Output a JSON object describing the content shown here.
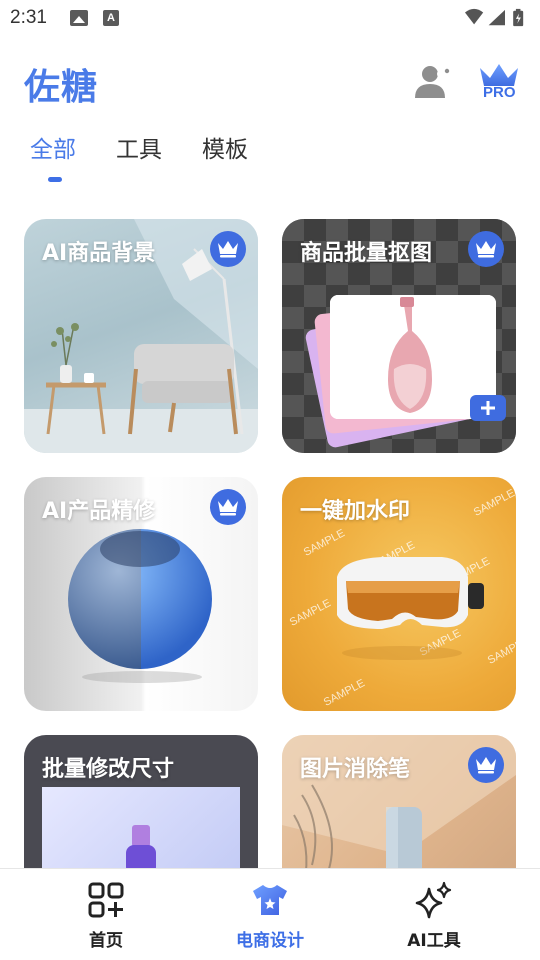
{
  "status_bar": {
    "time": "2:31",
    "notification_icons": [
      "image-icon",
      "a-icon"
    ],
    "right_icons": [
      "wifi-icon",
      "signal-icon",
      "battery-charging-icon"
    ]
  },
  "header": {
    "title": "佐糖",
    "pro_label": "PRO"
  },
  "tabs": [
    {
      "label": "全部",
      "active": true
    },
    {
      "label": "工具",
      "active": false
    },
    {
      "label": "模板",
      "active": false
    }
  ],
  "cards": [
    {
      "title": "AI商品背景",
      "pro": true
    },
    {
      "title": "商品批量抠图",
      "pro": true
    },
    {
      "title": "AI产品精修",
      "pro": true
    },
    {
      "title": "一键加水印",
      "pro": false
    },
    {
      "title": "批量修改尺寸",
      "pro": false
    },
    {
      "title": "图片消除笔",
      "pro": true
    }
  ],
  "watermark_text": "SAMPLE",
  "bottom_nav": [
    {
      "label": "首页",
      "icon": "grid-plus-icon",
      "active": false
    },
    {
      "label": "电商设计",
      "icon": "tshirt-icon",
      "active": true
    },
    {
      "label": "AI工具",
      "icon": "sparkle-icon",
      "active": false
    }
  ],
  "colors": {
    "accent": "#3e6fe6",
    "text": "#222222",
    "crown_badge": "#3f6ce0"
  }
}
